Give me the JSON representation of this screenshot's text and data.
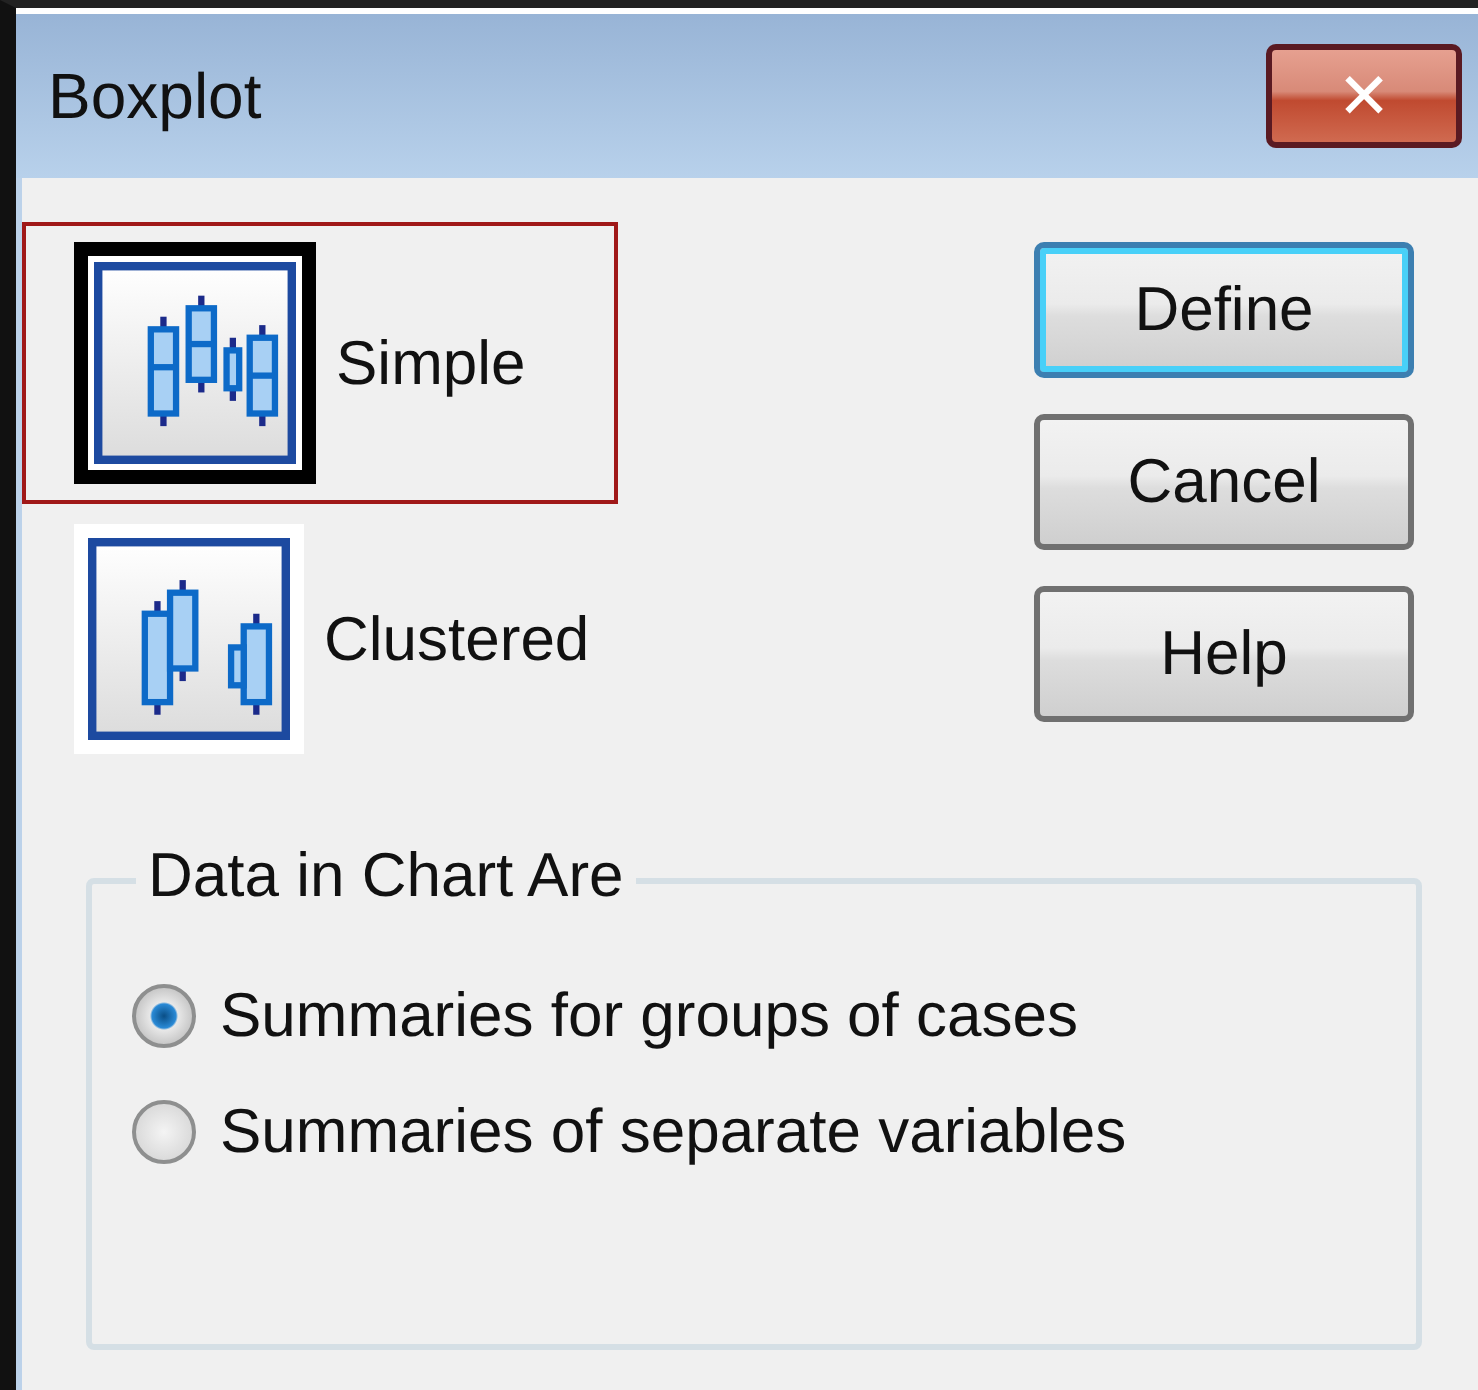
{
  "window": {
    "title": "Boxplot",
    "close": "✕"
  },
  "chart_types": [
    {
      "kind": "simple",
      "label": "Simple",
      "selected": true
    },
    {
      "kind": "clustered",
      "label": "Clustered",
      "selected": false
    }
  ],
  "buttons": [
    {
      "label": "Define",
      "default": true
    },
    {
      "label": "Cancel",
      "default": false
    },
    {
      "label": "Help",
      "default": false
    }
  ],
  "group": {
    "title": "Data in Chart Are",
    "options": [
      {
        "label": "Summaries for groups of cases",
        "selected": true
      },
      {
        "label": "Summaries of separate variables",
        "selected": false
      }
    ]
  }
}
